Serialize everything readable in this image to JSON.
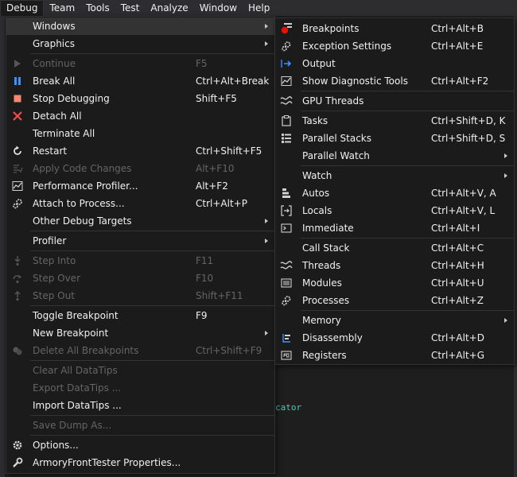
{
  "menubar": {
    "items": [
      "Debug",
      "Team",
      "Tools",
      "Test",
      "Analyze",
      "Window",
      "Help"
    ]
  },
  "background": {
    "code_fragment": "cator"
  },
  "debug_menu": {
    "items": [
      {
        "label": "Windows",
        "submenu": true,
        "icon": "none"
      },
      {
        "label": "Graphics",
        "submenu": true,
        "icon": "none"
      },
      {
        "label": "Continue",
        "shortcut": "F5",
        "disabled": true,
        "icon": "play-icon"
      },
      {
        "label": "Break All",
        "shortcut": "Ctrl+Alt+Break",
        "icon": "pause-icon"
      },
      {
        "label": "Stop Debugging",
        "shortcut": "Shift+F5",
        "icon": "stop-icon"
      },
      {
        "label": "Detach All",
        "icon": "x-icon"
      },
      {
        "label": "Terminate All",
        "icon": "none"
      },
      {
        "label": "Restart",
        "shortcut": "Ctrl+Shift+F5",
        "icon": "restart-icon"
      },
      {
        "label": "Apply Code Changes",
        "shortcut": "Alt+F10",
        "disabled": true,
        "icon": "apply-changes-icon"
      },
      {
        "label": "Performance Profiler...",
        "shortcut": "Alt+F2",
        "icon": "profiler-icon"
      },
      {
        "label": "Attach to Process...",
        "shortcut": "Ctrl+Alt+P",
        "icon": "gears-icon"
      },
      {
        "label": "Other Debug Targets",
        "submenu": true,
        "icon": "none"
      },
      {
        "label": "Profiler",
        "submenu": true,
        "icon": "none"
      },
      {
        "label": "Step Into",
        "shortcut": "F11",
        "disabled": true,
        "icon": "step-into-icon"
      },
      {
        "label": "Step Over",
        "shortcut": "F10",
        "disabled": true,
        "icon": "step-over-icon"
      },
      {
        "label": "Step Out",
        "shortcut": "Shift+F11",
        "disabled": true,
        "icon": "step-out-icon"
      },
      {
        "label": "Toggle Breakpoint",
        "shortcut": "F9",
        "icon": "none"
      },
      {
        "label": "New Breakpoint",
        "submenu": true,
        "icon": "none"
      },
      {
        "label": "Delete All Breakpoints",
        "shortcut": "Ctrl+Shift+F9",
        "disabled": true,
        "icon": "delete-breakpoints-icon"
      },
      {
        "label": "Clear All DataTips",
        "disabled": true,
        "icon": "none"
      },
      {
        "label": "Export DataTips ...",
        "disabled": true,
        "icon": "none"
      },
      {
        "label": "Import DataTips ...",
        "icon": "none"
      },
      {
        "label": "Save Dump As...",
        "disabled": true,
        "icon": "none"
      },
      {
        "label": "Options...",
        "icon": "gear-icon"
      },
      {
        "label": "ArmoryFrontTester Properties...",
        "icon": "wrench-icon"
      }
    ]
  },
  "windows_submenu": {
    "items": [
      {
        "label": "Breakpoints",
        "shortcut": "Ctrl+Alt+B",
        "icon": "breakpoints-icon"
      },
      {
        "label": "Exception Settings",
        "shortcut": "Ctrl+Alt+E",
        "icon": "exception-settings-icon"
      },
      {
        "label": "Output",
        "icon": "output-icon"
      },
      {
        "label": "Show Diagnostic Tools",
        "shortcut": "Ctrl+Alt+F2",
        "icon": "diagnostic-tools-icon"
      },
      {
        "label": "GPU Threads",
        "icon": "gpu-threads-icon"
      },
      {
        "label": "Tasks",
        "shortcut": "Ctrl+Shift+D, K",
        "icon": "tasks-icon"
      },
      {
        "label": "Parallel Stacks",
        "shortcut": "Ctrl+Shift+D, S",
        "icon": "parallel-stacks-icon"
      },
      {
        "label": "Parallel Watch",
        "submenu": true,
        "icon": "none"
      },
      {
        "label": "Watch",
        "submenu": true,
        "icon": "none"
      },
      {
        "label": "Autos",
        "shortcut": "Ctrl+Alt+V, A",
        "icon": "autos-icon"
      },
      {
        "label": "Locals",
        "shortcut": "Ctrl+Alt+V, L",
        "icon": "locals-icon"
      },
      {
        "label": "Immediate",
        "shortcut": "Ctrl+Alt+I",
        "icon": "immediate-icon"
      },
      {
        "label": "Call Stack",
        "shortcut": "Ctrl+Alt+C",
        "icon": "none"
      },
      {
        "label": "Threads",
        "shortcut": "Ctrl+Alt+H",
        "icon": "threads-icon"
      },
      {
        "label": "Modules",
        "shortcut": "Ctrl+Alt+U",
        "icon": "modules-icon"
      },
      {
        "label": "Processes",
        "shortcut": "Ctrl+Alt+Z",
        "icon": "processes-icon"
      },
      {
        "label": "Memory",
        "submenu": true,
        "icon": "none"
      },
      {
        "label": "Disassembly",
        "shortcut": "Ctrl+Alt+D",
        "icon": "disassembly-icon"
      },
      {
        "label": "Registers",
        "shortcut": "Ctrl+Alt+G",
        "icon": "registers-icon"
      }
    ]
  },
  "colors": {
    "menu_bg": "#1b1b1c",
    "highlight": "#333334",
    "disabled_text": "#656565",
    "breakpoint_red": "#e51400",
    "accent_blue": "#3794ff"
  }
}
